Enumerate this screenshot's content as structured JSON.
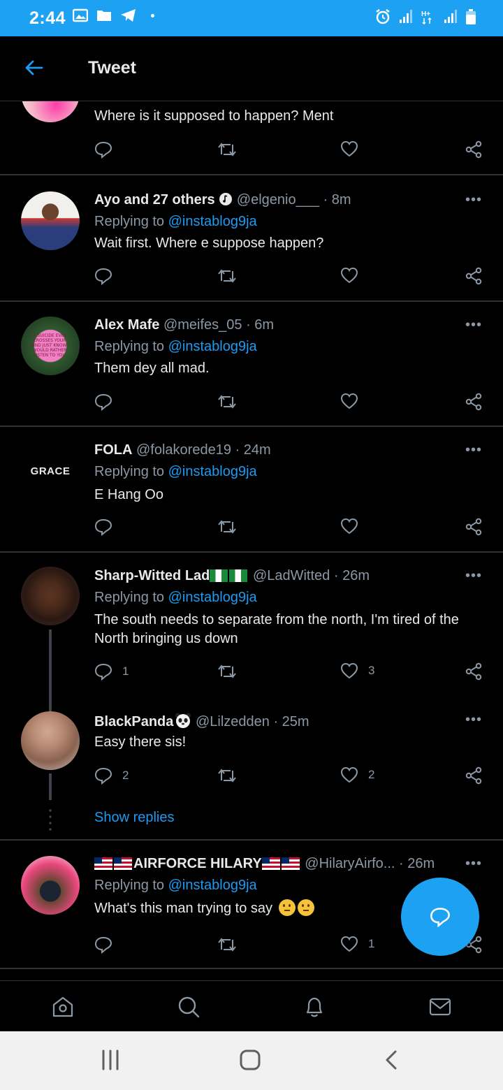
{
  "status_bar": {
    "time": "2:44"
  },
  "app_bar": {
    "title": "Tweet"
  },
  "top_partial": {
    "text": "Where is it supposed to happen? Ment"
  },
  "tweets": [
    {
      "name": "Ayo and 27 others",
      "handle": "@elgenio___",
      "time": "· 8m",
      "replying_prefix": "Replying to ",
      "replying_to": "@instablog9ja",
      "text": "Wait first. Where e suppose happen?",
      "replies": "",
      "likes": ""
    },
    {
      "name": "Alex Mafe",
      "handle": "@meifes_05",
      "time": "· 6m",
      "replying_prefix": "Replying to ",
      "replying_to": "@instablog9ja",
      "text": "Them dey all mad.",
      "replies": "",
      "likes": ""
    },
    {
      "name": "FOLA",
      "handle": "@folakorede19",
      "time": "· 24m",
      "replying_prefix": "Replying to ",
      "replying_to": "@instablog9ja",
      "text": "E Hang Oo",
      "replies": "",
      "likes": "",
      "avatar_text": "GRACE"
    },
    {
      "name": "Sharp-Witted Lad",
      "handle": "@LadWitted",
      "time": "· 26m",
      "replying_prefix": "Replying to ",
      "replying_to": "@instablog9ja",
      "text": "The south needs to separate from the north, I'm tired of the North bringing us down",
      "replies": "1",
      "likes": "3"
    },
    {
      "name": "BlackPanda",
      "handle": "@Lilzedden",
      "time": "· 25m",
      "text": "Easy there sis!",
      "replies": "2",
      "likes": "2"
    },
    {
      "name": "AIRFORCE HILARY",
      "handle": "@HilaryAirfo...",
      "time": "· 26m",
      "replying_prefix": "Replying to ",
      "replying_to": "@instablog9ja",
      "text": "What's this man trying to say",
      "replies": "",
      "likes": "1"
    }
  ],
  "show_replies": "Show replies",
  "colors": {
    "accent": "#1da1f2",
    "link": "#1d9bf0",
    "muted": "#8b98a5"
  },
  "bottom_nav": [
    "home-icon",
    "search-icon",
    "notifications-icon",
    "messages-icon"
  ]
}
